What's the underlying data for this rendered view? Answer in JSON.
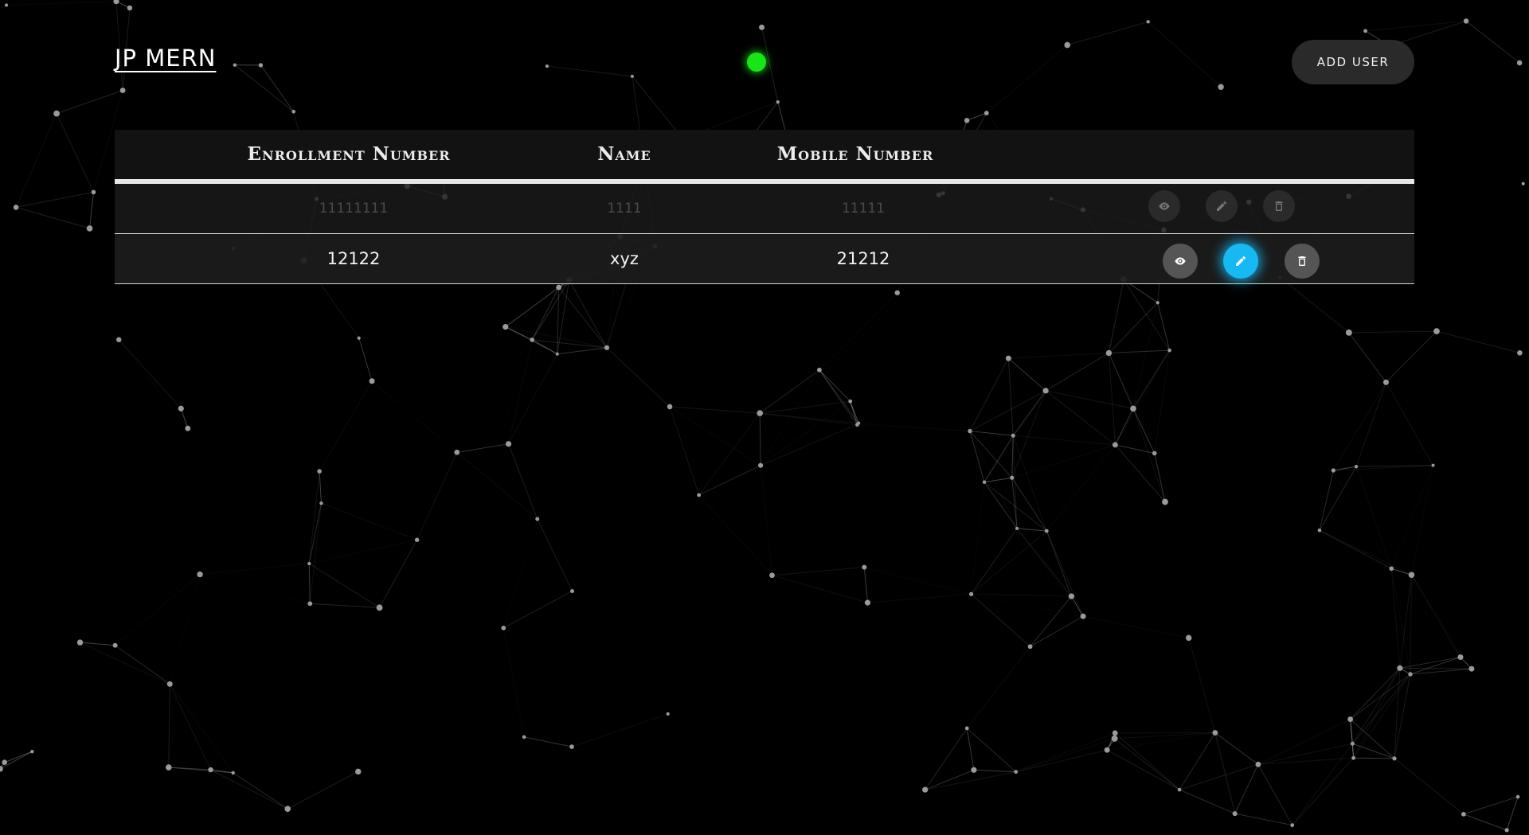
{
  "header": {
    "brand": "JP MERN",
    "add_user_label": "ADD USER",
    "status_color": "#16e516"
  },
  "table": {
    "columns": [
      "Enrollment Number",
      "Name",
      "Mobile Number"
    ],
    "rows": [
      {
        "enrollment": "11111111",
        "name": "1111",
        "mobile": "11111",
        "state": "faded"
      },
      {
        "enrollment": "12122",
        "name": "xyz",
        "mobile": "21212",
        "state": "normal"
      }
    ],
    "actions": [
      {
        "icon": "eye-icon",
        "color": "#555555"
      },
      {
        "icon": "pencil-icon",
        "color": "#17b9f2"
      },
      {
        "icon": "trash-icon",
        "color": "#555555"
      }
    ]
  },
  "background": {
    "style": "particle-network",
    "node_color": "#9a9a9a",
    "line_color": "#ffffff"
  }
}
